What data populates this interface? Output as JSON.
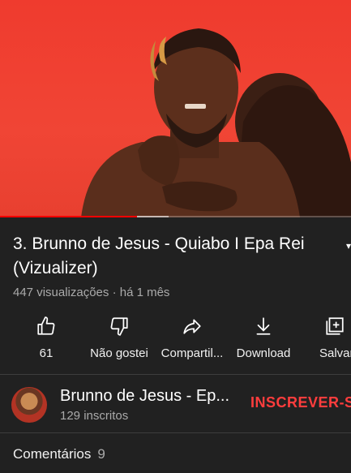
{
  "video": {
    "progress_played": 0.39,
    "progress_buffered_from": 0.39,
    "progress_buffered_to": 0.48
  },
  "title": "3. Brunno de Jesus - Quiabo I Epa Rei (Vizualizer)",
  "meta": "447 visualizações · há 1 mês",
  "actions": {
    "like": {
      "label": "61",
      "icon": "thumbs-up-icon"
    },
    "dislike": {
      "label": "Não gostei",
      "icon": "thumbs-down-icon"
    },
    "share": {
      "label": "Compartil...",
      "icon": "share-icon"
    },
    "download": {
      "label": "Download",
      "icon": "download-icon"
    },
    "save": {
      "label": "Salvar",
      "icon": "add-to-playlist-icon"
    }
  },
  "channel": {
    "name": "Brunno de Jesus - Ep...",
    "subscribers": "129 inscritos",
    "subscribe_label": "INSCREVER-SE"
  },
  "comments": {
    "label": "Comentários",
    "count": "9"
  },
  "colors": {
    "background": "#212121",
    "accent_red": "#ff3d3d",
    "video_bg": "#ef3b2e"
  }
}
